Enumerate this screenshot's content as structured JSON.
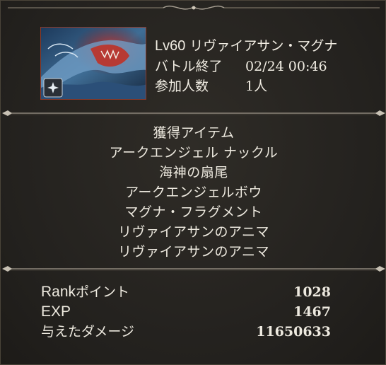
{
  "colors": {
    "background": "#2a2723",
    "text": "#ede9df",
    "thumbnail_border": "#8f3b2a",
    "ornament": "#a79f92"
  },
  "header": {
    "level_label": "Lv60",
    "boss_name": "リヴァイアサン・マグナ",
    "end_label": "バトル終了",
    "end_time": "02/24 00:46",
    "participants_label": "参加人数",
    "participants_value": "1人",
    "thumbnail_icon": "leviathan-magna-art"
  },
  "items": {
    "heading": "獲得アイテム",
    "list": [
      "アークエンジェル ナックル",
      "海神の扇尾",
      "アークエンジェルボウ",
      "マグナ・フラグメント",
      "リヴァイアサンのアニマ",
      "リヴァイアサンのアニマ"
    ]
  },
  "stats": {
    "rank": {
      "label_big": "Rank",
      "label_small": "ポイント",
      "value": "1028"
    },
    "exp": {
      "label_big": "EXP",
      "value": "1467"
    },
    "damage": {
      "label": "与えたダメージ",
      "value": "11650633"
    }
  }
}
